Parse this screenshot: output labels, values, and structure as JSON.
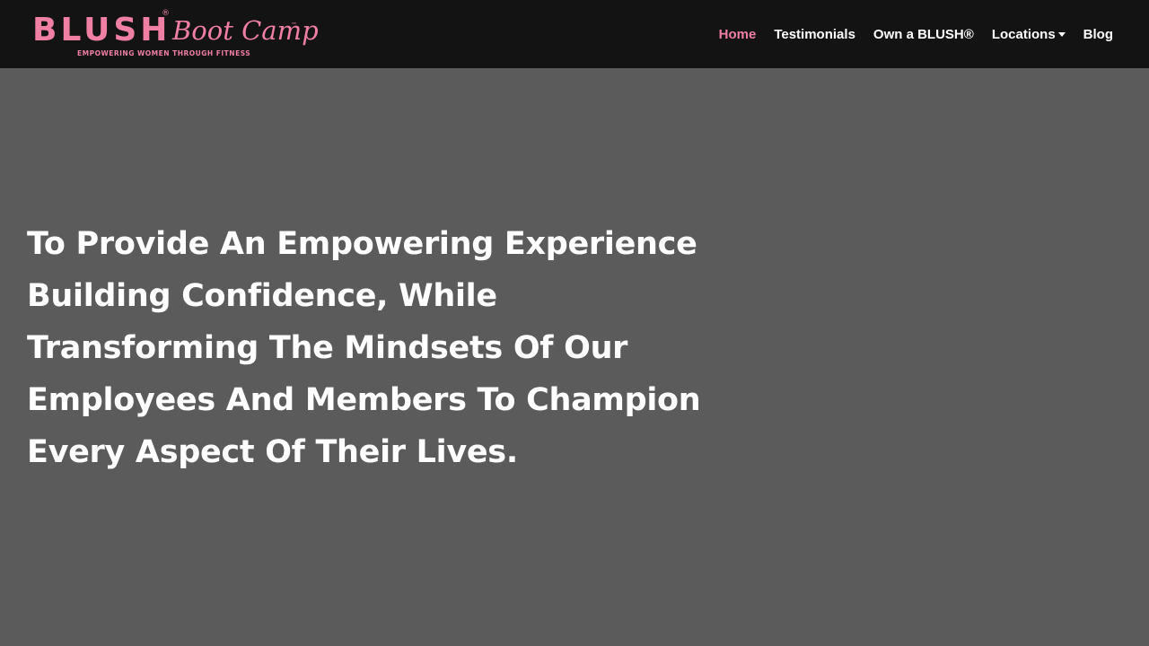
{
  "header": {
    "logo": {
      "wordmark": "BLUSH",
      "registered": "®",
      "script": "Boot Camp",
      "trademark": "™",
      "tagline": "EMPOWERING WOMEN THROUGH FITNESS"
    },
    "nav": [
      {
        "label": "Home",
        "active": true
      },
      {
        "label": "Testimonials",
        "active": false
      },
      {
        "label": "Own a BLUSH®",
        "active": false
      },
      {
        "label": "Locations",
        "active": false,
        "dropdown": true,
        "icon": "caret-down-icon"
      },
      {
        "label": "Blog",
        "active": false
      }
    ]
  },
  "hero": {
    "text": "To Provide An Empowering Experience Building Confidence, While Transforming The Mindsets Of Our Employees And Members To Champion Every Aspect Of Their Lives."
  },
  "colors": {
    "header_bg": "#131313",
    "page_bg": "#5b5b5b",
    "accent_pink": "#f07fa4",
    "text": "#ffffff"
  }
}
